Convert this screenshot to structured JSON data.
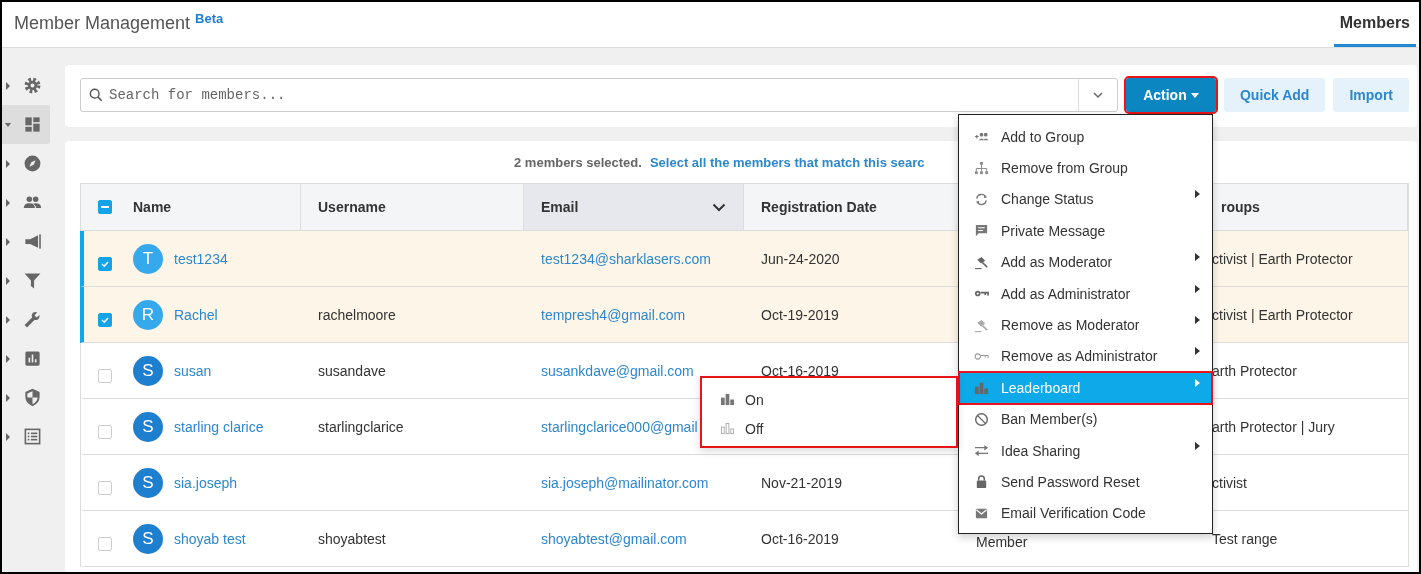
{
  "header": {
    "title": "Member Management",
    "badge": "Beta",
    "tabs": [
      {
        "label": "Members",
        "selected": true
      }
    ]
  },
  "sidebar": {
    "items": [
      {
        "selected": false
      },
      {
        "selected": true
      },
      {
        "selected": false
      },
      {
        "selected": false
      },
      {
        "selected": false
      },
      {
        "selected": false
      },
      {
        "selected": false
      },
      {
        "selected": false
      },
      {
        "selected": false
      },
      {
        "selected": false
      }
    ]
  },
  "search": {
    "placeholder": "Search for members..."
  },
  "buttons": [
    {
      "label": "Action",
      "kind": "primary",
      "has_caret": true,
      "highlighted": true
    },
    {
      "label": "Quick Add",
      "kind": "secondary",
      "has_caret": false,
      "highlighted": false
    },
    {
      "label": "Import",
      "kind": "secondary",
      "has_caret": false,
      "highlighted": false
    }
  ],
  "selection": {
    "count_text": "2 members selected.",
    "link": "Select all the members that match this searc"
  },
  "table": {
    "select_all": {
      "indeterminate": true
    },
    "columns": [
      {
        "label": "Name",
        "sorted": false
      },
      {
        "label": "Username",
        "sorted": false
      },
      {
        "label": "Email",
        "sorted": true
      },
      {
        "label": "Registration Date",
        "sorted": false
      },
      {},
      {
        "label": "roups",
        "sorted": false
      }
    ],
    "rows": [
      {
        "selected": true,
        "avatar": {
          "letter": "T",
          "color": "#35a9ec"
        },
        "name": "test1234",
        "email": "test1234@sharklasers.com",
        "registration_date": "Jun-24-2020",
        "groups": "ctivist | Earth Protector"
      },
      {
        "selected": true,
        "avatar": {
          "letter": "R",
          "color": "#35a9ec"
        },
        "name": "Rachel",
        "username": "rachelmoore",
        "email": "tempresh4@gmail.com",
        "registration_date": "Oct-19-2019",
        "groups": "ctivist | Earth Protector"
      },
      {
        "selected": false,
        "avatar": {
          "letter": "S",
          "color": "#1f7fcf"
        },
        "name": "susan",
        "username": "susandave",
        "email": "susankdave@gmail.com",
        "registration_date": "Oct-16-2019",
        "groups": "arth Protector"
      },
      {
        "selected": false,
        "avatar": {
          "letter": "S",
          "color": "#1f7fcf"
        },
        "name": "starling clarice",
        "username": "starlingclarice",
        "email": "starlingclarice000@gmail",
        "groups": "arth Protector | Jury"
      },
      {
        "selected": false,
        "avatar": {
          "letter": "S",
          "color": "#1f7fcf"
        },
        "name": "sia.joseph",
        "email": "sia.joseph@mailinator.com",
        "registration_date": "Nov-21-2019",
        "groups": "ctivist"
      },
      {
        "selected": false,
        "avatar": {
          "letter": "S",
          "color": "#1f7fcf"
        },
        "name": "shoyab test",
        "username": "shoyabtest",
        "email": "shoyabtest@gmail.com",
        "registration_date": "Oct-16-2019",
        "column_5": "Member",
        "groups": "Test range"
      }
    ]
  },
  "action_menu": {
    "items": [
      {
        "label": "Add to Group",
        "has_submenu": false,
        "selected": false,
        "highlighted": false
      },
      {
        "label": "Remove from Group",
        "has_submenu": false,
        "selected": false,
        "highlighted": false
      },
      {
        "label": "Change Status",
        "has_submenu": true,
        "selected": false,
        "highlighted": false
      },
      {
        "label": "Private Message",
        "has_submenu": false,
        "selected": false,
        "highlighted": false
      },
      {
        "label": "Add as Moderator",
        "has_submenu": true,
        "selected": false,
        "highlighted": false
      },
      {
        "label": "Add as Administrator",
        "has_submenu": true,
        "selected": false,
        "highlighted": false
      },
      {
        "label": "Remove as Moderator",
        "has_submenu": true,
        "selected": false,
        "highlighted": false
      },
      {
        "label": "Remove as Administrator",
        "has_submenu": true,
        "selected": false,
        "highlighted": false
      },
      {
        "label": "Leaderboard",
        "has_submenu": true,
        "selected": true,
        "highlighted": true
      },
      {
        "label": "Ban Member(s)",
        "has_submenu": false,
        "selected": false,
        "highlighted": false
      },
      {
        "label": "Idea Sharing",
        "has_submenu": true,
        "selected": false,
        "highlighted": false
      },
      {
        "label": "Send Password Reset",
        "has_submenu": false,
        "selected": false,
        "highlighted": false
      },
      {
        "label": "Email Verification Code",
        "has_submenu": false,
        "selected": false,
        "highlighted": false
      }
    ]
  },
  "submenu": {
    "highlighted": true,
    "items": [
      {
        "label": "On",
        "kind": "on"
      },
      {
        "label": "Off",
        "kind": "off"
      }
    ]
  }
}
